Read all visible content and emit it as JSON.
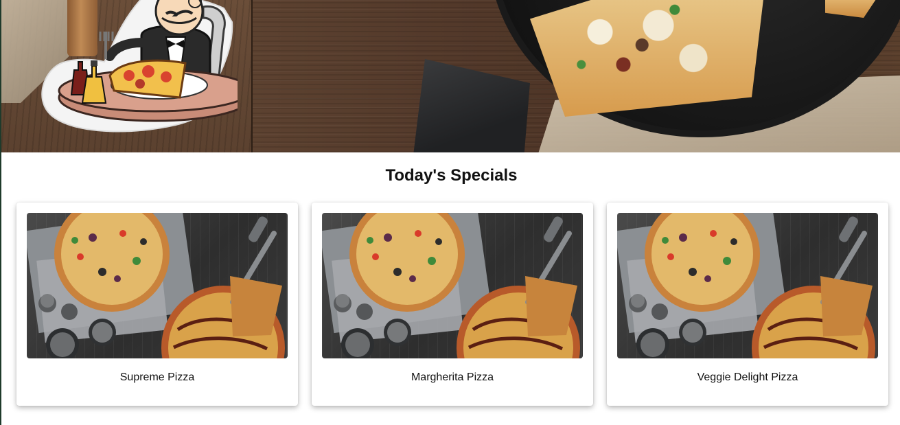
{
  "hero": {
    "logo_icon": "chef-eating-pizza-icon",
    "banner_image": "pizza-on-wooden-table"
  },
  "specials": {
    "title": "Today's Specials",
    "items": [
      {
        "name": "Supreme Pizza",
        "image_icon": "pizza-photo"
      },
      {
        "name": "Margherita Pizza",
        "image_icon": "pizza-photo"
      },
      {
        "name": "Veggie Delight Pizza",
        "image_icon": "pizza-photo"
      }
    ]
  }
}
